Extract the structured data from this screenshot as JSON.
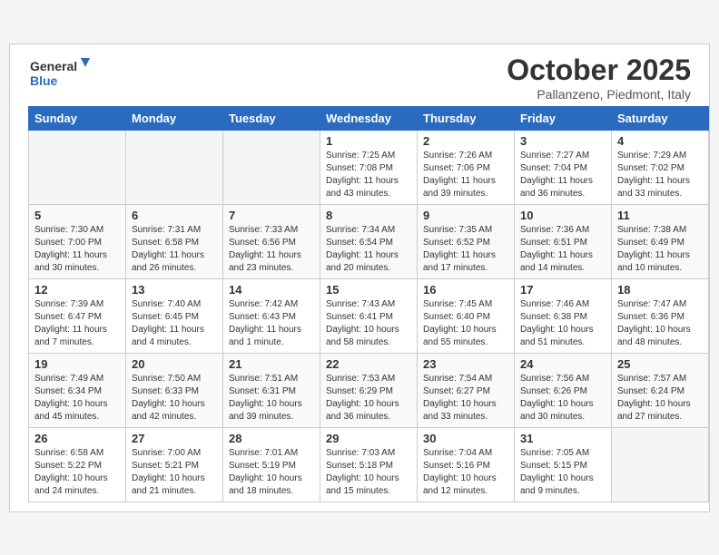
{
  "header": {
    "logo_line1": "General",
    "logo_line2": "Blue",
    "title": "October 2025",
    "subtitle": "Pallanzeno, Piedmont, Italy"
  },
  "days_of_week": [
    "Sunday",
    "Monday",
    "Tuesday",
    "Wednesday",
    "Thursday",
    "Friday",
    "Saturday"
  ],
  "weeks": [
    [
      {
        "day": "",
        "info": ""
      },
      {
        "day": "",
        "info": ""
      },
      {
        "day": "",
        "info": ""
      },
      {
        "day": "1",
        "info": "Sunrise: 7:25 AM\nSunset: 7:08 PM\nDaylight: 11 hours\nand 43 minutes."
      },
      {
        "day": "2",
        "info": "Sunrise: 7:26 AM\nSunset: 7:06 PM\nDaylight: 11 hours\nand 39 minutes."
      },
      {
        "day": "3",
        "info": "Sunrise: 7:27 AM\nSunset: 7:04 PM\nDaylight: 11 hours\nand 36 minutes."
      },
      {
        "day": "4",
        "info": "Sunrise: 7:29 AM\nSunset: 7:02 PM\nDaylight: 11 hours\nand 33 minutes."
      }
    ],
    [
      {
        "day": "5",
        "info": "Sunrise: 7:30 AM\nSunset: 7:00 PM\nDaylight: 11 hours\nand 30 minutes."
      },
      {
        "day": "6",
        "info": "Sunrise: 7:31 AM\nSunset: 6:58 PM\nDaylight: 11 hours\nand 26 minutes."
      },
      {
        "day": "7",
        "info": "Sunrise: 7:33 AM\nSunset: 6:56 PM\nDaylight: 11 hours\nand 23 minutes."
      },
      {
        "day": "8",
        "info": "Sunrise: 7:34 AM\nSunset: 6:54 PM\nDaylight: 11 hours\nand 20 minutes."
      },
      {
        "day": "9",
        "info": "Sunrise: 7:35 AM\nSunset: 6:52 PM\nDaylight: 11 hours\nand 17 minutes."
      },
      {
        "day": "10",
        "info": "Sunrise: 7:36 AM\nSunset: 6:51 PM\nDaylight: 11 hours\nand 14 minutes."
      },
      {
        "day": "11",
        "info": "Sunrise: 7:38 AM\nSunset: 6:49 PM\nDaylight: 11 hours\nand 10 minutes."
      }
    ],
    [
      {
        "day": "12",
        "info": "Sunrise: 7:39 AM\nSunset: 6:47 PM\nDaylight: 11 hours\nand 7 minutes."
      },
      {
        "day": "13",
        "info": "Sunrise: 7:40 AM\nSunset: 6:45 PM\nDaylight: 11 hours\nand 4 minutes."
      },
      {
        "day": "14",
        "info": "Sunrise: 7:42 AM\nSunset: 6:43 PM\nDaylight: 11 hours\nand 1 minute."
      },
      {
        "day": "15",
        "info": "Sunrise: 7:43 AM\nSunset: 6:41 PM\nDaylight: 10 hours\nand 58 minutes."
      },
      {
        "day": "16",
        "info": "Sunrise: 7:45 AM\nSunset: 6:40 PM\nDaylight: 10 hours\nand 55 minutes."
      },
      {
        "day": "17",
        "info": "Sunrise: 7:46 AM\nSunset: 6:38 PM\nDaylight: 10 hours\nand 51 minutes."
      },
      {
        "day": "18",
        "info": "Sunrise: 7:47 AM\nSunset: 6:36 PM\nDaylight: 10 hours\nand 48 minutes."
      }
    ],
    [
      {
        "day": "19",
        "info": "Sunrise: 7:49 AM\nSunset: 6:34 PM\nDaylight: 10 hours\nand 45 minutes."
      },
      {
        "day": "20",
        "info": "Sunrise: 7:50 AM\nSunset: 6:33 PM\nDaylight: 10 hours\nand 42 minutes."
      },
      {
        "day": "21",
        "info": "Sunrise: 7:51 AM\nSunset: 6:31 PM\nDaylight: 10 hours\nand 39 minutes."
      },
      {
        "day": "22",
        "info": "Sunrise: 7:53 AM\nSunset: 6:29 PM\nDaylight: 10 hours\nand 36 minutes."
      },
      {
        "day": "23",
        "info": "Sunrise: 7:54 AM\nSunset: 6:27 PM\nDaylight: 10 hours\nand 33 minutes."
      },
      {
        "day": "24",
        "info": "Sunrise: 7:56 AM\nSunset: 6:26 PM\nDaylight: 10 hours\nand 30 minutes."
      },
      {
        "day": "25",
        "info": "Sunrise: 7:57 AM\nSunset: 6:24 PM\nDaylight: 10 hours\nand 27 minutes."
      }
    ],
    [
      {
        "day": "26",
        "info": "Sunrise: 6:58 AM\nSunset: 5:22 PM\nDaylight: 10 hours\nand 24 minutes."
      },
      {
        "day": "27",
        "info": "Sunrise: 7:00 AM\nSunset: 5:21 PM\nDaylight: 10 hours\nand 21 minutes."
      },
      {
        "day": "28",
        "info": "Sunrise: 7:01 AM\nSunset: 5:19 PM\nDaylight: 10 hours\nand 18 minutes."
      },
      {
        "day": "29",
        "info": "Sunrise: 7:03 AM\nSunset: 5:18 PM\nDaylight: 10 hours\nand 15 minutes."
      },
      {
        "day": "30",
        "info": "Sunrise: 7:04 AM\nSunset: 5:16 PM\nDaylight: 10 hours\nand 12 minutes."
      },
      {
        "day": "31",
        "info": "Sunrise: 7:05 AM\nSunset: 5:15 PM\nDaylight: 10 hours\nand 9 minutes."
      },
      {
        "day": "",
        "info": ""
      }
    ]
  ]
}
